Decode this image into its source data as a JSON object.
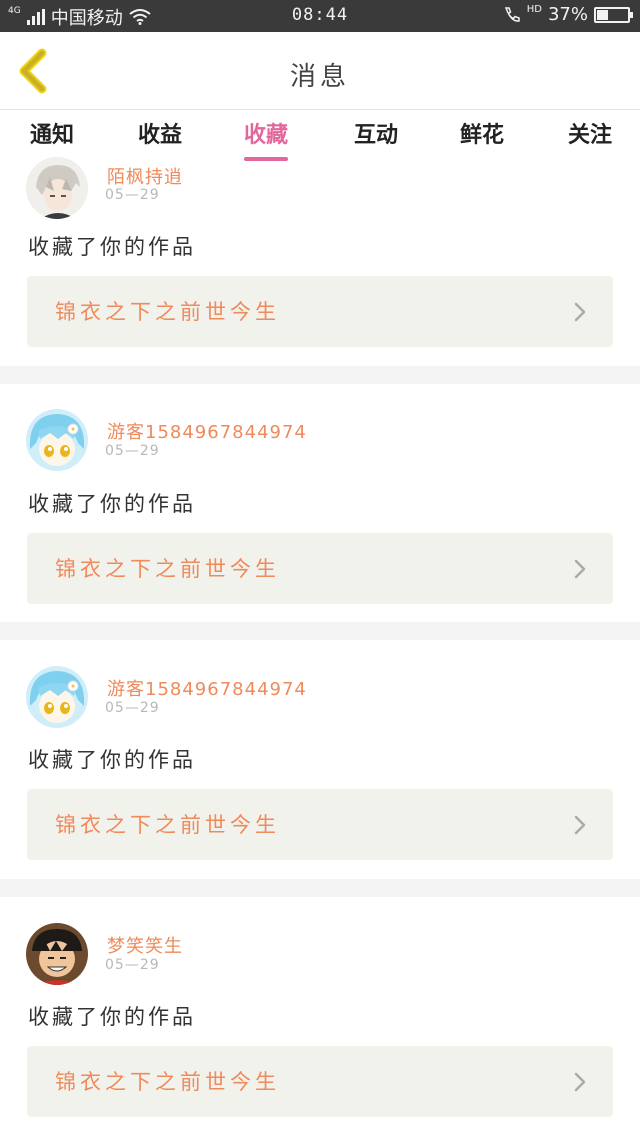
{
  "status_bar": {
    "network": "4G",
    "carrier": "中国移动",
    "time": "08:44",
    "hd_label": "HD",
    "battery": "37%",
    "battery_level": 0.37
  },
  "header": {
    "title": "消息",
    "back_icon": "chevron-left-icon"
  },
  "tabs": [
    {
      "label": "通知",
      "active": false
    },
    {
      "label": "收益",
      "active": false
    },
    {
      "label": "收藏",
      "active": true
    },
    {
      "label": "互动",
      "active": false
    },
    {
      "label": "鲜花",
      "active": false
    },
    {
      "label": "关注",
      "active": false
    }
  ],
  "colors": {
    "accent": "#e2679c",
    "orange": "#ef8a5a",
    "card_bg": "#f2f2ed",
    "separator": "#f4f4f4"
  },
  "messages": [
    {
      "username": "陌枫持逍",
      "date": "05—29",
      "action": "收藏了你的作品",
      "work_title": "锦衣之下之前世今生",
      "avatar_icon": "anime-boy-avatar-icon"
    },
    {
      "username": "游客1584967844974",
      "date": "05—29",
      "action": "收藏了你的作品",
      "work_title": "锦衣之下之前世今生",
      "avatar_icon": "anime-girl-avatar-icon"
    },
    {
      "username": "游客1584967844974",
      "date": "05—29",
      "action": "收藏了你的作品",
      "work_title": "锦衣之下之前世今生",
      "avatar_icon": "anime-girl-avatar-icon"
    },
    {
      "username": "梦笑笑生",
      "date": "05—29",
      "action": "收藏了你的作品",
      "work_title": "锦衣之下之前世今生",
      "avatar_icon": "straw-hat-avatar-icon"
    }
  ]
}
